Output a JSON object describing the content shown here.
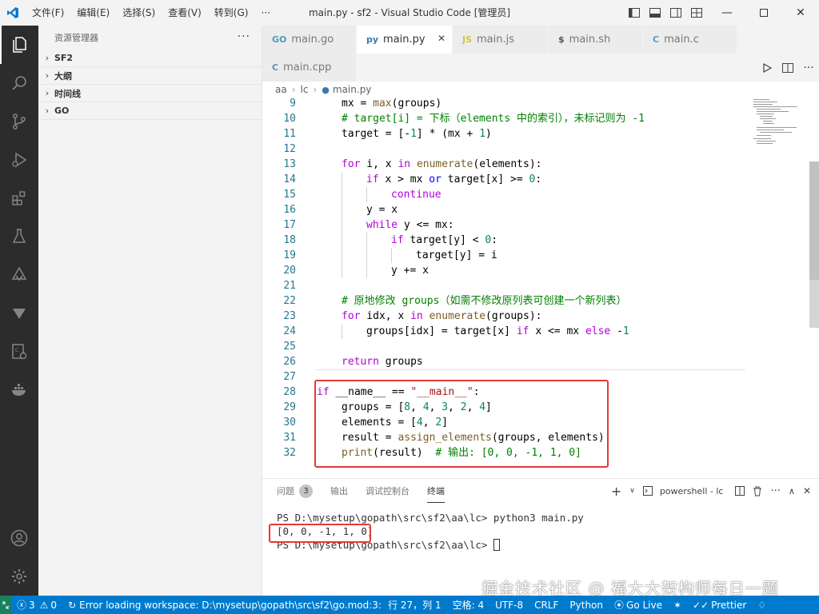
{
  "titlebar": {
    "menu": [
      "文件(F)",
      "编辑(E)",
      "选择(S)",
      "查看(V)",
      "转到(G)",
      "···"
    ],
    "title": "main.py - sf2 - Visual Studio Code [管理员]"
  },
  "sidebar": {
    "title": "资源管理器",
    "more": "···",
    "sections": [
      "SF2",
      "大纲",
      "时间线",
      "GO"
    ]
  },
  "tabs": [
    {
      "icon": "GO",
      "label": "main.go",
      "color": "#519aba"
    },
    {
      "icon": "py",
      "label": "main.py",
      "color": "#3c78aa",
      "active": true
    },
    {
      "icon": "JS",
      "label": "main.js",
      "color": "#cbcb41"
    },
    {
      "icon": "$",
      "label": "main.sh",
      "color": "#4d5a5e"
    },
    {
      "icon": "C",
      "label": "main.c",
      "color": "#519aba"
    },
    {
      "icon": "C",
      "label": "main.cpp",
      "color": "#519aba"
    }
  ],
  "breadcrumb": [
    "aa",
    "lc",
    "main.py"
  ],
  "code": [
    {
      "n": "9",
      "indent": 1,
      "html": "mx = <span class=\"fn\">max</span>(groups)"
    },
    {
      "n": "10",
      "indent": 1,
      "html": "<span class=\"cm\"># target[i] = 下标（elements 中的索引），未标记则为 -1</span>"
    },
    {
      "n": "11",
      "indent": 1,
      "html": "target = [-<span class=\"num\">1</span>] * (mx + <span class=\"num\">1</span>)"
    },
    {
      "n": "12",
      "indent": 1,
      "html": ""
    },
    {
      "n": "13",
      "indent": 1,
      "html": "<span class=\"ctrl\">for</span> i, x <span class=\"ctrl\">in</span> <span class=\"fn\">enumerate</span>(elements):"
    },
    {
      "n": "14",
      "indent": 2,
      "html": "<span class=\"ctrl\">if</span> x &gt; mx <span class=\"kw\">or</span> target[x] &gt;= <span class=\"num\">0</span>:"
    },
    {
      "n": "15",
      "indent": 3,
      "html": "<span class=\"ctrl\">continue</span>"
    },
    {
      "n": "16",
      "indent": 2,
      "html": "y = x"
    },
    {
      "n": "17",
      "indent": 2,
      "html": "<span class=\"ctrl\">while</span> y &lt;= mx:"
    },
    {
      "n": "18",
      "indent": 3,
      "html": "<span class=\"ctrl\">if</span> target[y] &lt; <span class=\"num\">0</span>:"
    },
    {
      "n": "19",
      "indent": 4,
      "html": "target[y] = i"
    },
    {
      "n": "20",
      "indent": 3,
      "html": "y += x"
    },
    {
      "n": "21",
      "indent": 1,
      "html": ""
    },
    {
      "n": "22",
      "indent": 1,
      "html": "<span class=\"cm\"># 原地修改 groups（如需不修改原列表可创建一个新列表）</span>"
    },
    {
      "n": "23",
      "indent": 1,
      "html": "<span class=\"ctrl\">for</span> idx, x <span class=\"ctrl\">in</span> <span class=\"fn\">enumerate</span>(groups):"
    },
    {
      "n": "24",
      "indent": 2,
      "html": "groups[idx] = target[x] <span class=\"ctrl\">if</span> x &lt;= mx <span class=\"ctrl\">else</span> -<span class=\"num\">1</span>"
    },
    {
      "n": "25",
      "indent": 1,
      "html": ""
    },
    {
      "n": "26",
      "indent": 1,
      "html": "<span class=\"ctrl\">return</span> groups"
    },
    {
      "n": "27",
      "indent": 0,
      "html": ""
    },
    {
      "n": "28",
      "indent": 0,
      "html": "<span class=\"ctrl\">if</span> __name__ == <span class=\"str\">\"__main__\"</span>:"
    },
    {
      "n": "29",
      "indent": 1,
      "html": "groups = [<span class=\"num\">8</span>, <span class=\"num\">4</span>, <span class=\"num\">3</span>, <span class=\"num\">2</span>, <span class=\"num\">4</span>]"
    },
    {
      "n": "30",
      "indent": 1,
      "html": "elements = [<span class=\"num\">4</span>, <span class=\"num\">2</span>]"
    },
    {
      "n": "31",
      "indent": 1,
      "html": "result = <span class=\"fn\">assign_elements</span>(groups, elements)"
    },
    {
      "n": "32",
      "indent": 1,
      "html": "<span class=\"fn\">print</span>(result)  <span class=\"cm\"># 输出: [0, 0, -1, 1, 0]</span>"
    }
  ],
  "panel": {
    "tabs": [
      "问题",
      "输出",
      "调试控制台",
      "终端"
    ],
    "problems_count": "3",
    "active_tab": "终端",
    "terminal_name": "powershell - lc",
    "terminal_lines": [
      "PS D:\\mysetup\\gopath\\src\\sf2\\aa\\lc> python3 main.py",
      "[0, 0, -1, 1, 0]",
      "PS D:\\mysetup\\gopath\\src\\sf2\\aa\\lc> "
    ]
  },
  "watermark": "掘金技术社区 @ 福大大架构师每日一题",
  "statusbar": {
    "errors": "3",
    "warnings": "0",
    "message": "Error loading workspace: D:\\mysetup\\gopath\\src\\sf2\\go.mod:3: invalid g",
    "position": "行 27，列 1",
    "spaces": "空格: 4",
    "encoding": "UTF-8",
    "eol": "CRLF",
    "language": "Python",
    "golive": "Go Live",
    "prettier": "Prettier"
  },
  "colors": {
    "statusbar": "#007acc",
    "activitybar": "#2c2c2c",
    "highlight": "#e53935"
  }
}
